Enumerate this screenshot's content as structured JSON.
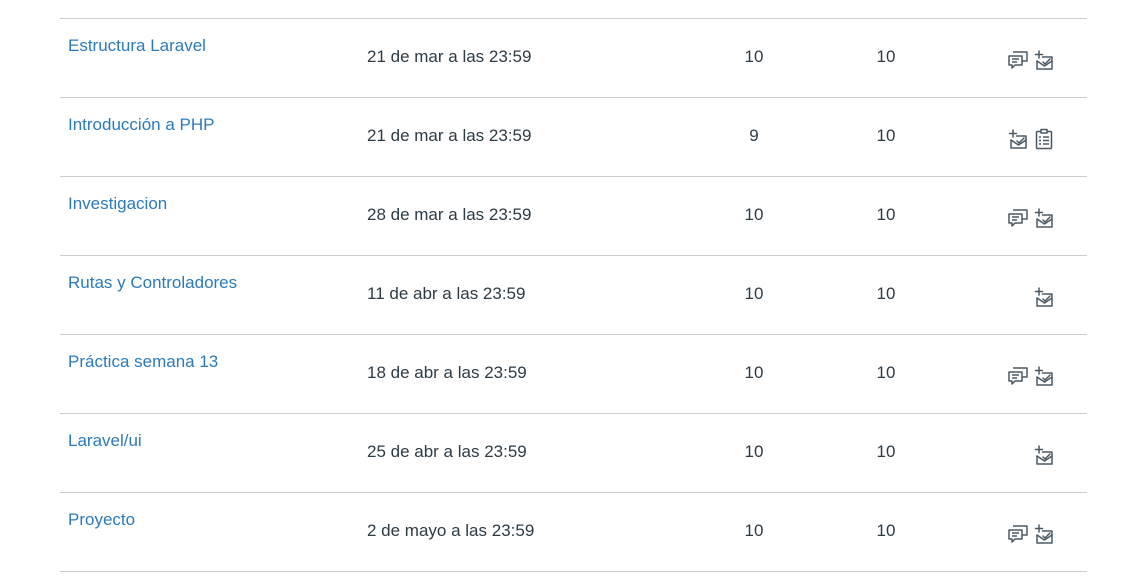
{
  "assignments": [
    {
      "title": "Estructura Laravel",
      "due": "21 de mar a las 23:59",
      "score": "10",
      "out_of": "10",
      "icons": [
        "comments-icon",
        "submission-icon"
      ]
    },
    {
      "title": "Introducción a PHP",
      "due": "21 de mar a las 23:59",
      "score": "9",
      "out_of": "10",
      "icons": [
        "submission-icon",
        "rubric-icon"
      ]
    },
    {
      "title": "Investigacion",
      "due": "28 de mar a las 23:59",
      "score": "10",
      "out_of": "10",
      "icons": [
        "comments-icon",
        "submission-icon"
      ]
    },
    {
      "title": "Rutas y Controladores",
      "due": "11 de abr a las 23:59",
      "score": "10",
      "out_of": "10",
      "icons": [
        "submission-icon"
      ]
    },
    {
      "title": "Práctica semana 13",
      "due": "18 de abr a las 23:59",
      "score": "10",
      "out_of": "10",
      "icons": [
        "comments-icon",
        "submission-icon"
      ]
    },
    {
      "title": "Laravel/ui",
      "due": "25 de abr a las 23:59",
      "score": "10",
      "out_of": "10",
      "icons": [
        "submission-icon"
      ]
    },
    {
      "title": "Proyecto",
      "due": "2 de mayo a las 23:59",
      "score": "10",
      "out_of": "10",
      "icons": [
        "comments-icon",
        "submission-icon"
      ]
    }
  ],
  "colors": {
    "link": "#2b7abc",
    "text": "#2d3b45",
    "divider": "#c7cdd1",
    "icon": "#4a5863"
  }
}
